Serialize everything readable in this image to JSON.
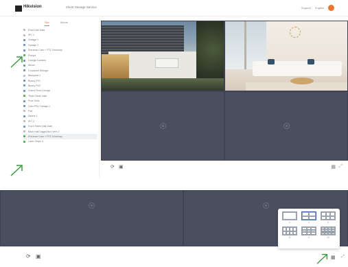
{
  "app": {
    "brand": "Hikvision",
    "page_title": "Client Storage Service",
    "top_links": [
      "Support",
      "English"
    ]
  },
  "sidebar": {
    "tabs": [
      {
        "label": "Site",
        "active": true
      },
      {
        "label": "Album",
        "active": false
      }
    ],
    "items": [
      {
        "label": "Front Hall Gate",
        "color": "#bbbbbb"
      },
      {
        "label": "IPC 1",
        "color": "#bbbbbb"
      },
      {
        "label": "Garage 1",
        "color": "#6c8fb5"
      },
      {
        "label": "Garage 2",
        "color": "#6c8fb5"
      },
      {
        "label": "Entrance Cam + PTZ Driveway",
        "color": "#6c8fb5",
        "selected": false
      },
      {
        "label": "Pumpa",
        "color": "#4caf50"
      },
      {
        "label": "Lounge Camera",
        "color": "#6c8fb5"
      },
      {
        "label": "Atrium",
        "color": "#6c8fb5"
      },
      {
        "label": "Courtyard Storage",
        "color": "#6c8fb5"
      },
      {
        "label": "Backyard 1",
        "color": "#bbbbbb"
      },
      {
        "label": "Bunny PV1",
        "color": "#6c8fb5"
      },
      {
        "label": "Bunny PV2",
        "color": "#6c8fb5"
      },
      {
        "label": "Grand Floor Lounge",
        "color": "#6c8fb5"
      },
      {
        "label": "Three Bank Gate",
        "color": "#4caf50"
      },
      {
        "label": "Pool Deck",
        "color": "#6c8fb5"
      },
      {
        "label": "Cam PSU Garage 2",
        "color": "#6c8fb5"
      },
      {
        "label": "Fire",
        "color": "#bbbbbb"
      },
      {
        "label": "Sauna 1",
        "color": "#6c8fb5"
      },
      {
        "label": "IPC 2",
        "color": "#bbbbbb"
      },
      {
        "label": "Front Street Hall Gate",
        "color": "#6c8fb5"
      },
      {
        "label": "Back Hall Loggia Box Vent 2",
        "color": "#bbbbbb"
      },
      {
        "label": "Entrance Cam + PTZ Driveway",
        "color": "#4caf50",
        "selected": true
      },
      {
        "label": "Lawn Slope 4",
        "color": "#4caf50"
      }
    ]
  },
  "layout_popup": {
    "options": [
      "1",
      "4",
      "6",
      "8",
      "9",
      "16"
    ],
    "active_index": 1
  }
}
